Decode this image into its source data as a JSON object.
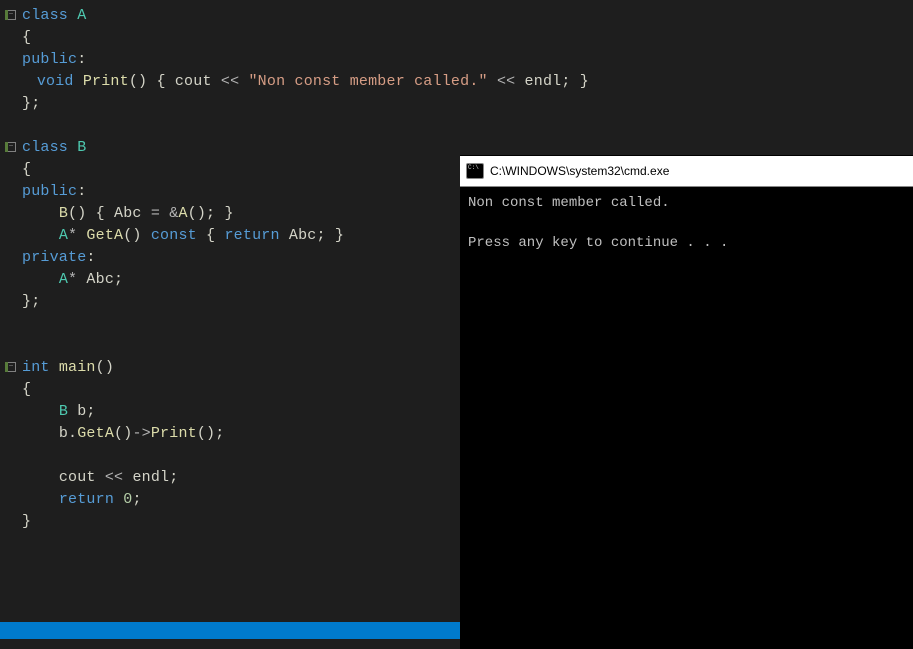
{
  "code": {
    "lines": [
      {
        "fold": "minus",
        "bar": "green",
        "tokens": [
          {
            "c": "kw",
            "t": "class"
          },
          {
            "c": "punc",
            "t": " "
          },
          {
            "c": "type",
            "t": "A"
          }
        ]
      },
      {
        "fold": "",
        "bar": "green",
        "tokens": [
          {
            "c": "punc",
            "t": "{"
          }
        ]
      },
      {
        "fold": "",
        "bar": "green",
        "tokens": [
          {
            "c": "kw",
            "t": "public"
          },
          {
            "c": "punc",
            "t": ":"
          }
        ]
      },
      {
        "fold": "",
        "bar": "green",
        "tokens": [
          {
            "c": "punc",
            "t": "    "
          },
          {
            "c": "kw",
            "t": "void"
          },
          {
            "c": "punc",
            "t": " "
          },
          {
            "c": "fn",
            "t": "Print"
          },
          {
            "c": "punc",
            "t": "() { "
          },
          {
            "c": "ident",
            "t": "cout"
          },
          {
            "c": "punc",
            "t": " "
          },
          {
            "c": "op",
            "t": "<<"
          },
          {
            "c": "punc",
            "t": " "
          },
          {
            "c": "str",
            "t": "\"Non const member called.\""
          },
          {
            "c": "punc",
            "t": " "
          },
          {
            "c": "op",
            "t": "<<"
          },
          {
            "c": "punc",
            "t": " "
          },
          {
            "c": "ident",
            "t": "endl"
          },
          {
            "c": "punc",
            "t": "; }"
          }
        ]
      },
      {
        "fold": "",
        "bar": "green",
        "tokens": [
          {
            "c": "punc",
            "t": "};"
          }
        ]
      },
      {
        "fold": "",
        "bar": "",
        "tokens": [
          {
            "c": "punc",
            "t": ""
          }
        ]
      },
      {
        "fold": "minus",
        "bar": "green",
        "tokens": [
          {
            "c": "kw",
            "t": "class"
          },
          {
            "c": "punc",
            "t": " "
          },
          {
            "c": "type",
            "t": "B"
          }
        ]
      },
      {
        "fold": "",
        "bar": "green",
        "tokens": [
          {
            "c": "punc",
            "t": "{"
          }
        ]
      },
      {
        "fold": "",
        "bar": "green",
        "tokens": [
          {
            "c": "kw",
            "t": "public"
          },
          {
            "c": "punc",
            "t": ":"
          }
        ]
      },
      {
        "fold": "",
        "bar": "green",
        "tokens": [
          {
            "c": "punc",
            "t": "    "
          },
          {
            "c": "fn",
            "t": "B"
          },
          {
            "c": "punc",
            "t": "() { "
          },
          {
            "c": "ident",
            "t": "Abc"
          },
          {
            "c": "punc",
            "t": " "
          },
          {
            "c": "op",
            "t": "="
          },
          {
            "c": "punc",
            "t": " "
          },
          {
            "c": "op",
            "t": "&"
          },
          {
            "c": "fn",
            "t": "A"
          },
          {
            "c": "punc",
            "t": "(); }"
          }
        ]
      },
      {
        "fold": "",
        "bar": "green",
        "tokens": [
          {
            "c": "punc",
            "t": "    "
          },
          {
            "c": "type",
            "t": "A"
          },
          {
            "c": "op",
            "t": "*"
          },
          {
            "c": "punc",
            "t": " "
          },
          {
            "c": "fn",
            "t": "GetA"
          },
          {
            "c": "punc",
            "t": "() "
          },
          {
            "c": "kw",
            "t": "const"
          },
          {
            "c": "punc",
            "t": " { "
          },
          {
            "c": "kw",
            "t": "return"
          },
          {
            "c": "punc",
            "t": " "
          },
          {
            "c": "ident",
            "t": "Abc"
          },
          {
            "c": "punc",
            "t": "; }"
          }
        ]
      },
      {
        "fold": "",
        "bar": "green",
        "tokens": [
          {
            "c": "kw",
            "t": "private"
          },
          {
            "c": "punc",
            "t": ":"
          }
        ]
      },
      {
        "fold": "",
        "bar": "green",
        "tokens": [
          {
            "c": "punc",
            "t": "    "
          },
          {
            "c": "type",
            "t": "A"
          },
          {
            "c": "op",
            "t": "*"
          },
          {
            "c": "punc",
            "t": " "
          },
          {
            "c": "ident",
            "t": "Abc"
          },
          {
            "c": "punc",
            "t": ";"
          }
        ]
      },
      {
        "fold": "",
        "bar": "green",
        "tokens": [
          {
            "c": "punc",
            "t": "};"
          }
        ]
      },
      {
        "fold": "",
        "bar": "",
        "tokens": [
          {
            "c": "punc",
            "t": ""
          }
        ]
      },
      {
        "fold": "",
        "bar": "",
        "tokens": [
          {
            "c": "punc",
            "t": ""
          }
        ]
      },
      {
        "fold": "minus",
        "bar": "green",
        "tokens": [
          {
            "c": "kw",
            "t": "int"
          },
          {
            "c": "punc",
            "t": " "
          },
          {
            "c": "fn",
            "t": "main"
          },
          {
            "c": "punc",
            "t": "()"
          }
        ]
      },
      {
        "fold": "",
        "bar": "green",
        "tokens": [
          {
            "c": "punc",
            "t": "{"
          }
        ]
      },
      {
        "fold": "",
        "bar": "green",
        "tokens": [
          {
            "c": "punc",
            "t": "    "
          },
          {
            "c": "type",
            "t": "B"
          },
          {
            "c": "punc",
            "t": " "
          },
          {
            "c": "ident",
            "t": "b"
          },
          {
            "c": "punc",
            "t": ";"
          }
        ]
      },
      {
        "fold": "",
        "bar": "green",
        "tokens": [
          {
            "c": "punc",
            "t": "    "
          },
          {
            "c": "ident",
            "t": "b"
          },
          {
            "c": "punc",
            "t": "."
          },
          {
            "c": "fn",
            "t": "GetA"
          },
          {
            "c": "punc",
            "t": "()"
          },
          {
            "c": "op",
            "t": "->"
          },
          {
            "c": "fn",
            "t": "Print"
          },
          {
            "c": "punc",
            "t": "();"
          }
        ]
      },
      {
        "fold": "",
        "bar": "yellow",
        "tokens": [
          {
            "c": "punc",
            "t": ""
          }
        ]
      },
      {
        "fold": "",
        "bar": "green",
        "tokens": [
          {
            "c": "punc",
            "t": "    "
          },
          {
            "c": "ident",
            "t": "cout"
          },
          {
            "c": "punc",
            "t": " "
          },
          {
            "c": "op",
            "t": "<<"
          },
          {
            "c": "punc",
            "t": " "
          },
          {
            "c": "ident",
            "t": "endl"
          },
          {
            "c": "punc",
            "t": ";"
          }
        ]
      },
      {
        "fold": "",
        "bar": "green",
        "tokens": [
          {
            "c": "punc",
            "t": "    "
          },
          {
            "c": "kw",
            "t": "return"
          },
          {
            "c": "punc",
            "t": " "
          },
          {
            "c": "num",
            "t": "0"
          },
          {
            "c": "punc",
            "t": ";"
          }
        ]
      },
      {
        "fold": "",
        "bar": "green",
        "tokens": [
          {
            "c": "punc",
            "t": "}"
          }
        ]
      }
    ]
  },
  "console": {
    "title": "C:\\WINDOWS\\system32\\cmd.exe",
    "output": "Non const member called.\n\nPress any key to continue . . ."
  }
}
